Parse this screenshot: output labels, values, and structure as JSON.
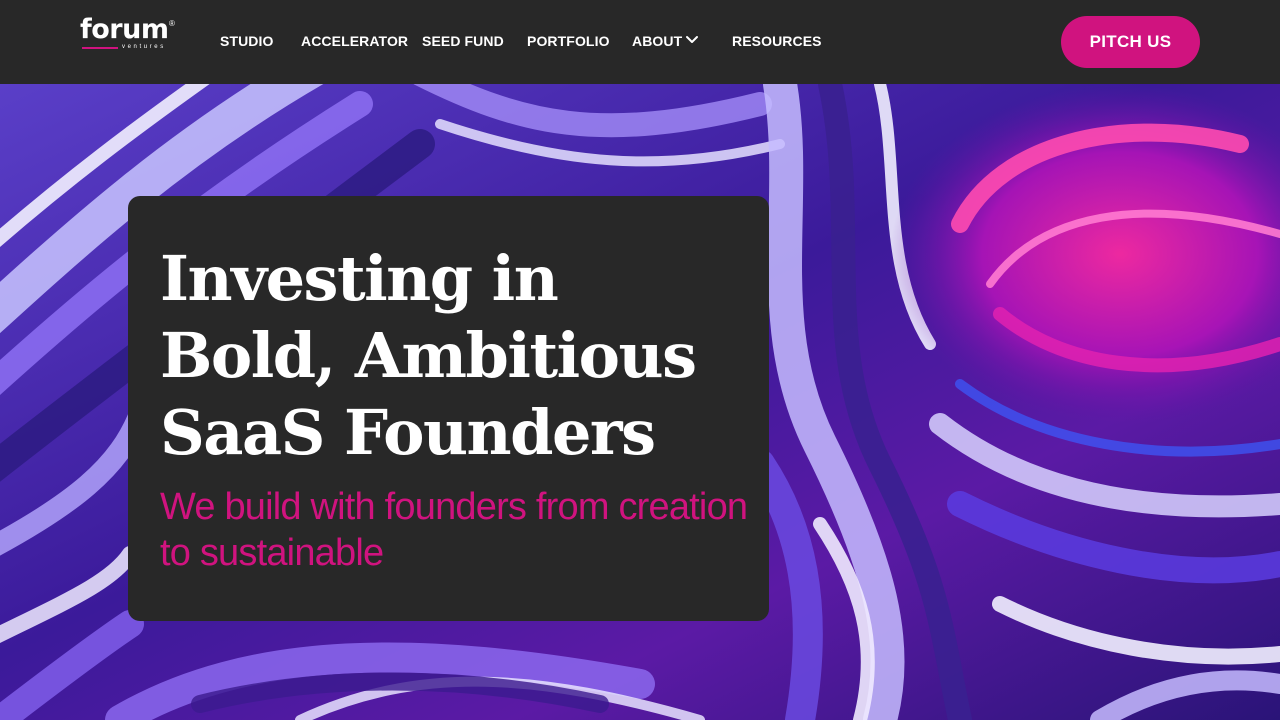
{
  "brand": {
    "logo_text": "forum",
    "logo_sub": "ventures",
    "logo_mark": "®",
    "accent_color": "#d0137f"
  },
  "nav": {
    "items": [
      {
        "label": "STUDIO"
      },
      {
        "label": "ACCELERATOR"
      },
      {
        "label": "SEED FUND"
      },
      {
        "label": "PORTFOLIO"
      },
      {
        "label": "ABOUT",
        "icon": "chevron-down-icon"
      },
      {
        "label": "RESOURCES"
      }
    ],
    "cta_label": "PITCH US"
  },
  "hero": {
    "headline": "Investing in Bold, Ambitious SaaS Founders",
    "subline": "We build with founders from creation to sustainable",
    "background": "purple-marble-abstract"
  }
}
